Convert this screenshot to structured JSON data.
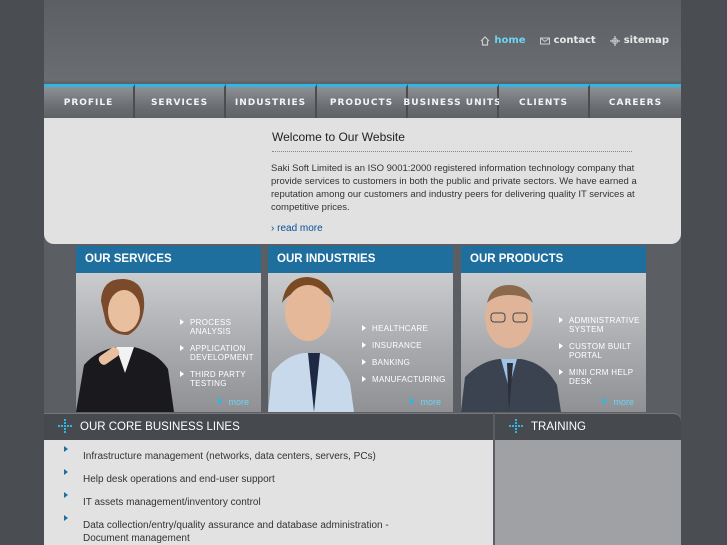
{
  "toplinks": {
    "home": "home",
    "contact": "contact",
    "sitemap": "sitemap"
  },
  "nav": [
    "PROFILE",
    "SERVICES",
    "INDUSTRIES",
    "PRODUCTS",
    "BUSINESS UNITS",
    "CLIENTS",
    "CAREERS"
  ],
  "welcome": {
    "title": "Welcome to Our Website",
    "body": "Saki Soft Limited is an ISO 9001:2000 registered information technology company that provide services to customers in both the public and private sectors. We have earned a reputation among our customers and industry peers for delivering quality IT services at competitive prices.",
    "read_more": "read more"
  },
  "panels": {
    "services": {
      "title": "OUR SERVICES",
      "items": [
        "PROCESS ANALYSIS",
        "APPLICATION DEVELOPMENT",
        "THIRD PARTY TESTING"
      ],
      "more": "more"
    },
    "industries": {
      "title": "OUR INDUSTRIES",
      "items": [
        "HEALTHCARE",
        "INSURANCE",
        "BANKING",
        "MANUFACTURING"
      ],
      "more": "more"
    },
    "products": {
      "title": "OUR PRODUCTS",
      "items": [
        "ADMINISTRATIVE SYSTEM",
        "CUSTOM BUILT PORTAL",
        "MINI CRM HELP DESK"
      ],
      "more": "more"
    }
  },
  "core": {
    "title": "OUR CORE BUSINESS LINES",
    "items": [
      "Infrastructure management (networks, data centers, servers, PCs)",
      "Help desk operations and end-user support",
      "IT assets management/inventory control",
      "Data collection/entry/quality assurance and database administration -Document management"
    ]
  },
  "training": {
    "title": "TRAINING"
  },
  "colors": {
    "accent": "#2fb6e3",
    "panel_header": "#1f6f9e",
    "background": "#4a4d52"
  }
}
